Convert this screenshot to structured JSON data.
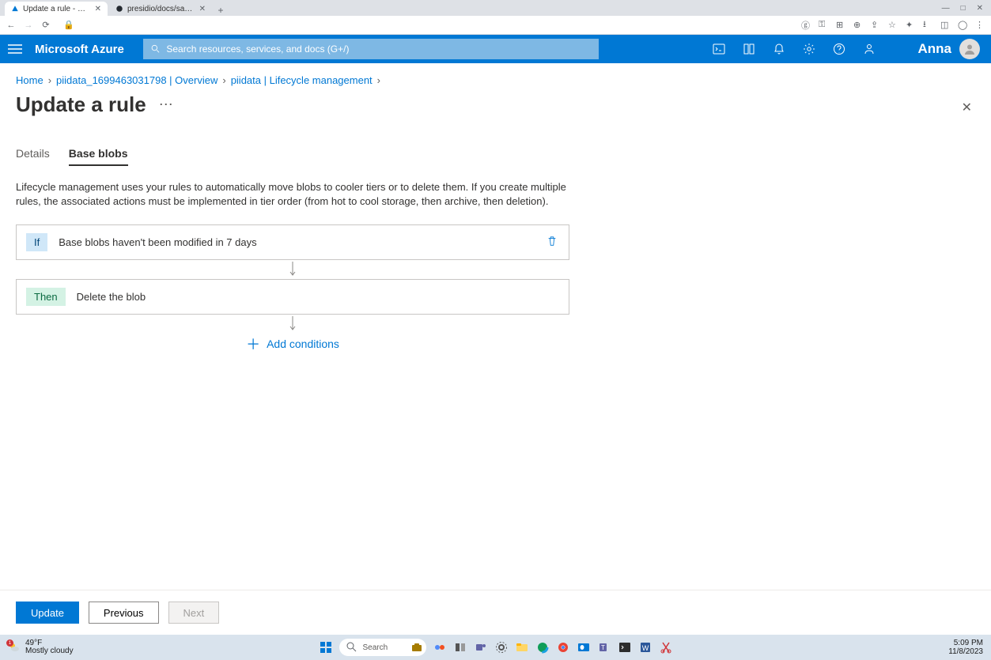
{
  "browser": {
    "tabs": [
      {
        "title": "Update a rule - Microsoft Azure"
      },
      {
        "title": "presidio/docs/samples/deploy…"
      }
    ]
  },
  "azure": {
    "brand": "Microsoft Azure",
    "searchPlaceholder": "Search resources, services, and docs (G+/)",
    "user": "Anna"
  },
  "breadcrumb": {
    "home": "Home",
    "item1": "piidata_1699463031798 | Overview",
    "item2": "piidata | Lifecycle management"
  },
  "page": {
    "title": "Update a rule",
    "tabDetails": "Details",
    "tabBaseBlobs": "Base blobs",
    "description": "Lifecycle management uses your rules to automatically move blobs to cooler tiers or to delete them. If you create multiple rules, the associated actions must be implemented in tier order (from hot to cool storage, then archive, then deletion).",
    "ifLabel": "If",
    "ifText": "Base blobs haven't been modified in 7 days",
    "thenLabel": "Then",
    "thenText": "Delete the blob",
    "addConditions": "Add conditions"
  },
  "footer": {
    "update": "Update",
    "previous": "Previous",
    "next": "Next"
  },
  "taskbar": {
    "temp": "49°F",
    "weather": "Mostly cloudy",
    "search": "Search",
    "time": "5:09 PM",
    "date": "11/8/2023"
  }
}
